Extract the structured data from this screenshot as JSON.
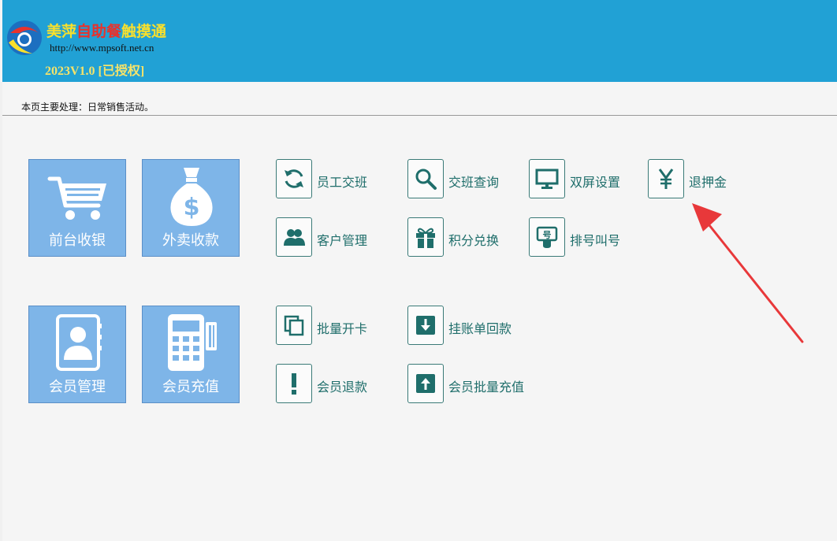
{
  "header": {
    "brand_part1": "美萍",
    "brand_part2": "自助餐",
    "brand_part3": "触摸通",
    "url": "http://www.mpsoft.net.cn",
    "version": "2023V1.0 [已授权]"
  },
  "page": {
    "description": "本页主要处理：日常销售活动。"
  },
  "big_tiles": [
    {
      "label": "前台收银",
      "icon": "shopping-cart-icon"
    },
    {
      "label": "外卖收款",
      "icon": "money-bag-icon"
    },
    {
      "label": "会员管理",
      "icon": "member-card-icon"
    },
    {
      "label": "会员充值",
      "icon": "card-terminal-icon"
    }
  ],
  "small_tiles": [
    {
      "label": "员工交班",
      "icon": "refresh-icon"
    },
    {
      "label": "交班查询",
      "icon": "search-icon"
    },
    {
      "label": "双屏设置",
      "icon": "monitor-icon"
    },
    {
      "label": "退押金",
      "icon": "yen-icon"
    },
    {
      "label": "客户管理",
      "icon": "users-icon"
    },
    {
      "label": "积分兑换",
      "icon": "gift-icon"
    },
    {
      "label": "排号叫号",
      "icon": "queue-number-icon"
    },
    {
      "label": "批量开卡",
      "icon": "copy-icon"
    },
    {
      "label": "挂账单回款",
      "icon": "download-icon"
    },
    {
      "label": "会员退款",
      "icon": "exclamation-icon"
    },
    {
      "label": "会员批量充值",
      "icon": "upload-icon"
    }
  ],
  "colors": {
    "header_bg": "#21a1d5",
    "tile_bg": "#7eb5e8",
    "small_text": "#1f6e6b",
    "arrow": "#e8383a"
  }
}
